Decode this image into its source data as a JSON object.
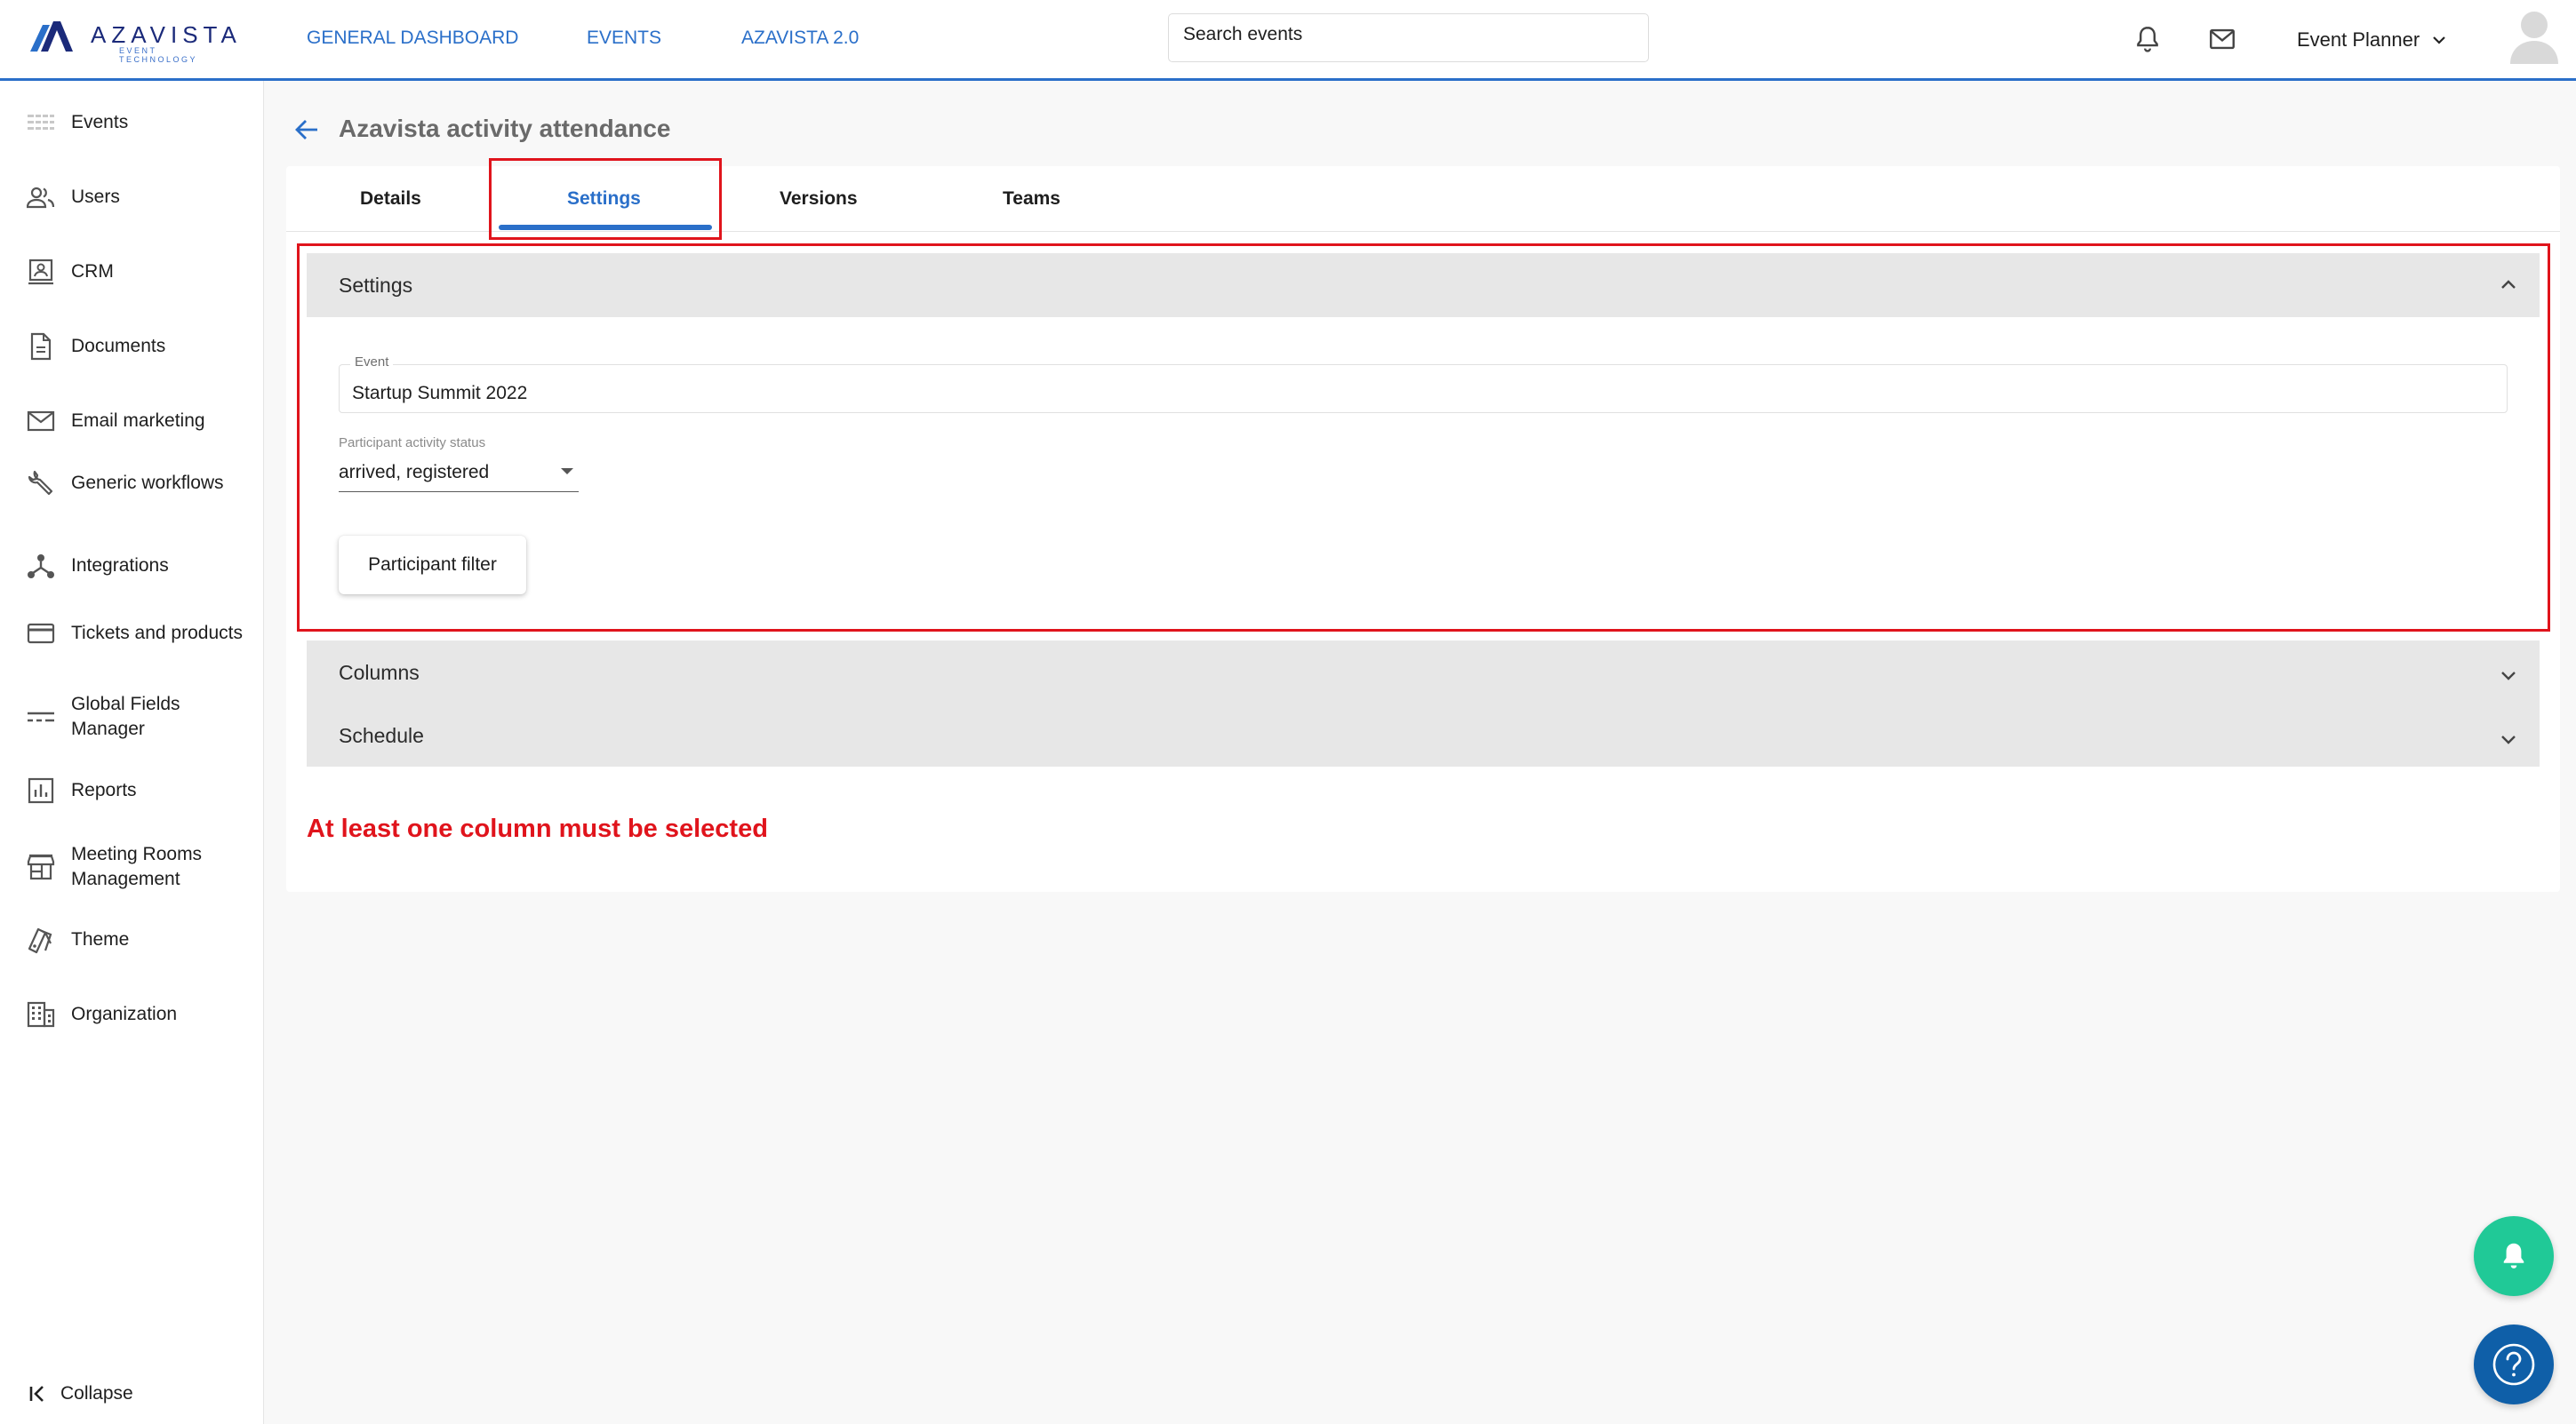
{
  "brand": {
    "name": "AZAVISTA",
    "tagline": "EVENT TECHNOLOGY"
  },
  "topnav": [
    "GENERAL DASHBOARD",
    "EVENTS",
    "AZAVISTA 2.0"
  ],
  "search": {
    "placeholder": "Search events"
  },
  "user": {
    "role": "Event Planner"
  },
  "sidebar": {
    "items": [
      {
        "label": "Events",
        "icon": "events-icon"
      },
      {
        "label": "Users",
        "icon": "users-icon"
      },
      {
        "label": "CRM",
        "icon": "crm-icon"
      },
      {
        "label": "Documents",
        "icon": "document-icon"
      },
      {
        "label": "Email marketing",
        "icon": "mail-icon"
      },
      {
        "label": "Generic workflows",
        "icon": "wrench-icon"
      },
      {
        "label": "Integrations",
        "icon": "integrations-icon"
      },
      {
        "label": "Tickets and products",
        "icon": "ticket-icon"
      },
      {
        "label": "Global Fields Manager",
        "icon": "fields-icon"
      },
      {
        "label": "Reports",
        "icon": "reports-icon"
      },
      {
        "label": "Meeting Rooms Management",
        "icon": "store-icon"
      },
      {
        "label": "Theme",
        "icon": "theme-icon"
      },
      {
        "label": "Organization",
        "icon": "organization-icon"
      }
    ],
    "collapse_label": "Collapse"
  },
  "page": {
    "title": "Azavista activity attendance"
  },
  "tabs": [
    {
      "label": "Details",
      "active": false
    },
    {
      "label": "Settings",
      "active": true
    },
    {
      "label": "Versions",
      "active": false
    },
    {
      "label": "Teams",
      "active": false
    }
  ],
  "settings_panel": {
    "title": "Settings",
    "expanded": true,
    "event_field": {
      "label": "Event",
      "value": "Startup Summit 2022"
    },
    "status_field": {
      "label": "Participant activity status",
      "value": "arrived, registered"
    },
    "filter_button": "Participant filter"
  },
  "columns_panel": {
    "title": "Columns",
    "expanded": false
  },
  "schedule_panel": {
    "title": "Schedule",
    "expanded": false
  },
  "error": "At least one column must be selected",
  "colors": {
    "accent": "#2a6fc9",
    "error": "#e0141c",
    "fab_bell": "#20c997",
    "fab_help": "#0f5fa8"
  }
}
